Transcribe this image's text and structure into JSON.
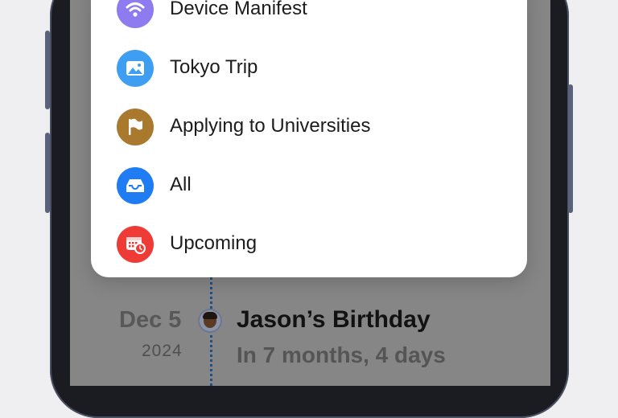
{
  "menu": {
    "items": [
      {
        "label": "Device Manifest",
        "icon": "wifi-icon",
        "color": "#8e7bf0"
      },
      {
        "label": "Tokyo Trip",
        "icon": "photo-icon",
        "color": "#3e9ff2"
      },
      {
        "label": "Applying to Universities",
        "icon": "flag-icon",
        "color": "#a9792e"
      },
      {
        "label": "All",
        "icon": "tray-icon",
        "color": "#1f7cf2"
      },
      {
        "label": "Upcoming",
        "icon": "calendar-clock-icon",
        "color": "#ef3b36"
      }
    ]
  },
  "timeline": {
    "date": "Dec 5",
    "year": "2024",
    "event_title": "Jason’s Birthday",
    "event_subtitle": "In 7 months, 4 days"
  }
}
